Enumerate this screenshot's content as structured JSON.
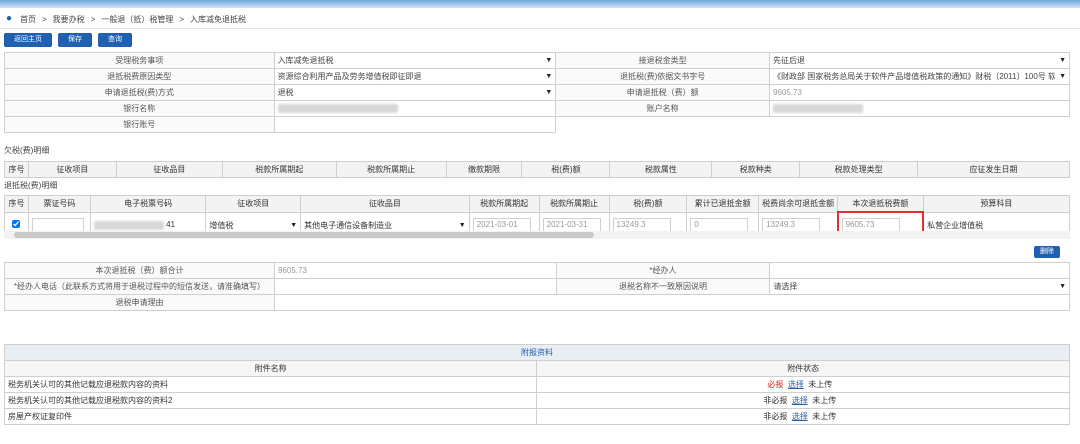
{
  "breadcrumb": [
    "首页",
    "我要办税",
    "一般退（抵）税管理",
    "入库减免退抵税"
  ],
  "breadcrumb_sep": ">",
  "buttons": {
    "back": "返回主页",
    "save": "保存",
    "query": "查询"
  },
  "form": {
    "r1": {
      "l1": "受理税务事项",
      "v1": "入库减免退抵税",
      "l2": "接退税金类型",
      "v2": "先征后退"
    },
    "r2": {
      "l1": "退抵税费原因类型",
      "v1": "资源综合利用产品及劳务增值税即征即退",
      "l2": "退抵税(费)依据文书字号",
      "v2": "《财政部 国家税务总局关于软件产品增值税政策的通知》财税〔2011〕100号 软件产品"
    },
    "r3": {
      "l1": "申请退抵税(费)方式",
      "v1": "退税",
      "l2": "申请退抵税（费）额",
      "v2": "9605.73"
    },
    "r4": {
      "l1": "银行名称",
      "l2": "账户名称"
    },
    "r5": {
      "l1": "银行账号"
    }
  },
  "owe": {
    "title": "欠税(费)明细",
    "headers": [
      "序号",
      "征收项目",
      "征收品目",
      "税款所属期起",
      "税款所属期止",
      "缴款期限",
      "税(费)额",
      "税款属性",
      "税款种类",
      "税款处理类型",
      "应征发生日期"
    ]
  },
  "refund": {
    "title": "退抵税(费)明细",
    "headers": [
      "序号",
      "票证号码",
      "电子税票号码",
      "征收项目",
      "征收品目",
      "税款所属期起",
      "税款所属期止",
      "税(费)额",
      "累计已退抵金额",
      "税费尚余可退抵金额",
      "本次退抵税费额",
      "预算科目"
    ],
    "row": {
      "ticket_tail": "41",
      "item": "增值税",
      "category": "其他电子通信设备制造业",
      "start": "2021-03-01",
      "end": "2021-03-31",
      "amount": "13249.3",
      "refunded": "0",
      "remain": "13249.3",
      "this": "9605.73",
      "budget": "私营企业增值税"
    }
  },
  "delete_label": "删除",
  "summary": {
    "l1": "本次退抵税（费）额合计",
    "v1": "9605.73",
    "l2": "*经办人",
    "l3": "*经办人电话（此联系方式将用于退税过程中的短信发送，请准确填写）",
    "l4": "退税名称不一致原因说明",
    "v4": "请选择",
    "l5": "退税申请理由"
  },
  "attach": {
    "title": "附报资料",
    "h1": "附件名称",
    "h2": "附件状态",
    "rows": [
      {
        "name": "税务机关认可的其他记载应退税款内容的资料",
        "req": "必报",
        "choose": "选择",
        "status": "未上传"
      },
      {
        "name": "税务机关认可的其他记载应退税款内容的资料2",
        "req": "非必报",
        "choose": "选择",
        "status": "未上传"
      },
      {
        "name": "房屋产权证复印件",
        "req": "非必报",
        "choose": "选择",
        "status": "未上传"
      }
    ]
  }
}
